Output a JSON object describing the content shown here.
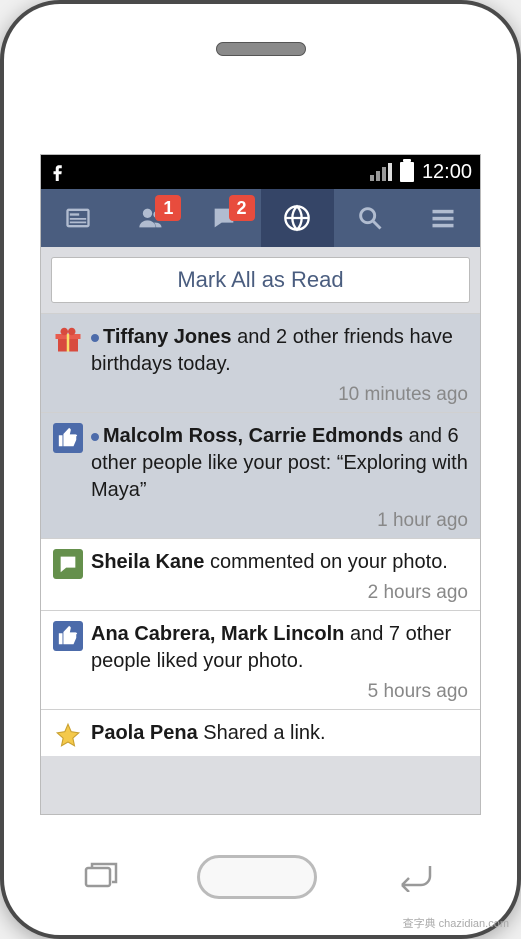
{
  "status": {
    "time": "12:00"
  },
  "nav": {
    "friends_badge": "1",
    "messages_badge": "2"
  },
  "mark_read": "Mark All as Read",
  "notifications": [
    {
      "icon": "gift",
      "unread": true,
      "bold1": "Tiffany Jones",
      "mid1": " and 2 other friends have birthdays today.",
      "time": "10 minutes ago"
    },
    {
      "icon": "like",
      "unread": true,
      "bold1": "Malcolm Ross, Carrie Edmonds",
      "mid1": " and 6 other people like your post: “Exploring with Maya”",
      "time": "1 hour ago"
    },
    {
      "icon": "comment",
      "unread": false,
      "bold1": "Sheila Kane",
      "mid1": " commented on your photo.",
      "time": "2 hours ago"
    },
    {
      "icon": "like",
      "unread": false,
      "bold1": "Ana Cabrera, Mark Lincoln",
      "mid1": " and 7 other people liked your photo.",
      "time": "5 hours ago"
    },
    {
      "icon": "star",
      "unread": false,
      "bold1": "Paola Pena",
      "mid1": " Shared a link.",
      "time": ""
    }
  ],
  "watermark": "查字典 chazidian.com"
}
